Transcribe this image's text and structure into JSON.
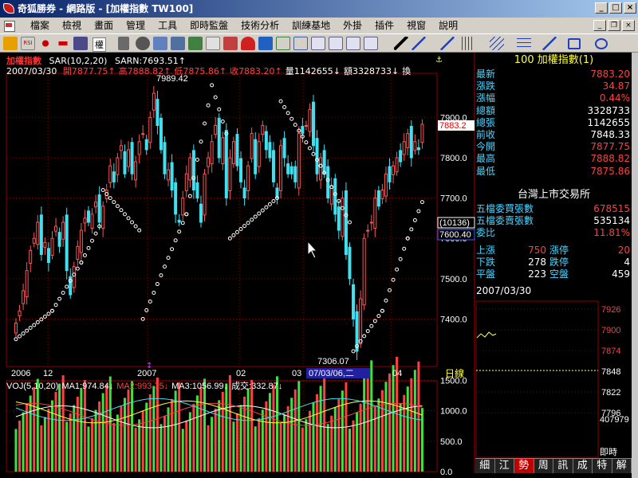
{
  "window": {
    "title": "奇狐勝券 - 網路版 - [加權指數 TW100]",
    "buttons": [
      "_",
      "□",
      "×"
    ]
  },
  "menu": [
    "檔案",
    "檢視",
    "畫面",
    "管理",
    "工具",
    "即時監盤",
    "技術分析",
    "訓練基地",
    "外掛",
    "插件",
    "視窗",
    "說明"
  ],
  "mdi_buttons": [
    "_",
    "❐",
    "×"
  ],
  "toolbar": {
    "combo": "權",
    "items": [
      "home-icon",
      "rsi-icon",
      "move-icon",
      "arrows-icon",
      "chart-icon",
      "compare-icon",
      "book-icon",
      "copy-icon",
      "search-icon",
      "refresh-icon",
      "alarm-icon",
      "pen-icon",
      "grid-icon",
      "table-icon",
      "cursor-icon",
      "line-icon",
      "parallel-icon",
      "rect-icon",
      "ellipse-icon"
    ]
  },
  "chart": {
    "name": "加權指數",
    "indicator": "SAR(10,2,20)",
    "sarn_label": "SARN:7693.51↑",
    "date": "2007/03/30",
    "info": [
      {
        "label": "開",
        "value": "7877.75↑",
        "color": "#ff4040"
      },
      {
        "label": "高",
        "value": "7888.82↑",
        "color": "#ff4040"
      },
      {
        "label": "低",
        "value": "7875.86↑",
        "color": "#ff4040"
      },
      {
        "label": "收",
        "value": "7883.20↑",
        "color": "#ff4040"
      },
      {
        "label": "量",
        "value": "1142655↓",
        "color": "#ffffff"
      },
      {
        "label": "額",
        "value": "3328733↓",
        "color": "#ffffff"
      },
      {
        "label": "換",
        "value": "",
        "color": "#ffffff"
      }
    ],
    "high_label": "7989.42",
    "low_label": "7306.07",
    "price_ticks": [
      "7900.0",
      "7800.0",
      "7700.0",
      "7600.0",
      "7500.0",
      "7400.0"
    ],
    "price_marker": "7883.2",
    "cursor_y_label": "7600.40",
    "cursor_x_label": "(10136)",
    "x_labels": [
      "2006",
      "12",
      "2007",
      "02",
      "03",
      "04"
    ],
    "cursor_date": "07/03/06,二",
    "timeframe": "日線",
    "vol_title": "VOJ(5,10,20)",
    "vol_info": [
      {
        "label": "MA1:",
        "value": "974.84↓",
        "color": "#ffffff"
      },
      {
        "label": "MA2:",
        "value": "993.75↓",
        "color": "#ff4040"
      },
      {
        "label": "MA3:",
        "value": "1056.99↓",
        "color": "#ffffff"
      },
      {
        "label": "成交:",
        "value": "332.87↓",
        "color": "#ffffff"
      }
    ],
    "vol_ticks": [
      "1500.0",
      "1000.0",
      "500.0",
      "0.0"
    ]
  },
  "quote": {
    "code": "100",
    "name": "加權指數",
    "badge": "(1)",
    "rows": [
      {
        "label": "最新",
        "value": "7883.20",
        "color": "#ff4040"
      },
      {
        "label": "漲跌",
        "value": "34.87",
        "color": "#ff4040"
      },
      {
        "label": "漲幅",
        "value": "0.44%",
        "color": "#ff4040"
      },
      {
        "label": "總額",
        "value": "3328733",
        "color": "#ffffff"
      },
      {
        "label": "總張",
        "value": "1142655",
        "color": "#ffffff"
      },
      {
        "label": "前收",
        "value": "7848.33",
        "color": "#ffffff"
      },
      {
        "label": "今開",
        "value": "7877.75",
        "color": "#ff4040"
      },
      {
        "label": "最高",
        "value": "7888.82",
        "color": "#ff4040"
      },
      {
        "label": "最低",
        "value": "7875.86",
        "color": "#ff4040"
      }
    ],
    "exchange": "台灣上市交易所",
    "rows2": [
      {
        "label": "五檔委買張數",
        "value": "678515",
        "color": "#ff4040"
      },
      {
        "label": "五檔委賣張數",
        "value": "535134",
        "color": "#ffffff"
      },
      {
        "label": "委比",
        "value": "11.81%",
        "color": "#ff4040"
      }
    ],
    "stats": [
      {
        "l1": "上漲",
        "v1": "750",
        "l2": "漲停",
        "v2": "20",
        "c": "#ff4040"
      },
      {
        "l1": "下跌",
        "v1": "278",
        "l2": "跌停",
        "v2": "4",
        "c": "#ffffff"
      },
      {
        "l1": "平盤",
        "v1": "223",
        "l2": "空盤",
        "v2": "459",
        "c": "#ffffff"
      }
    ],
    "date": "2007/03/30",
    "mini_ticks": [
      "7926",
      "7900",
      "7874",
      "7848",
      "7822",
      "7796"
    ],
    "mini_vol": "407979",
    "mini_label": "即時"
  },
  "bottom_tabs": [
    "細",
    "江",
    "勢",
    "周",
    "訊",
    "成",
    "特",
    "解"
  ],
  "colors": {
    "up": "#ff5555",
    "down": "#40e0f0",
    "grid": "#8b0000",
    "sar": "#ffffff"
  }
}
